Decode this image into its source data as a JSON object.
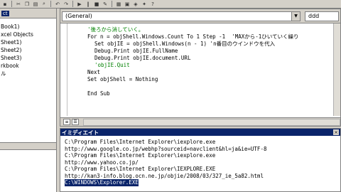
{
  "toolbar": {
    "undo_icon": "undo-icon",
    "redo_icon": "redo-icon",
    "run_icon": "run-icon",
    "pause_icon": "pause-icon",
    "stop_icon": "stop-icon"
  },
  "project": {
    "title": "ct",
    "items": [
      "Book1)",
      "xcel Objects",
      "Sheet1)",
      "Sheet2)",
      "Sheet3)",
      "rkbook",
      "ル"
    ]
  },
  "code": {
    "object_combo": "(General)",
    "proc_combo": "ddd",
    "lines": [
      {
        "text": "'後ろから消していく。",
        "type": "comment",
        "indent": 2
      },
      {
        "text": "For n = objShell.Windows.Count To 1 Step -1  'MAXから-1ひいていく繰り",
        "type": "code",
        "indent": 2
      },
      {
        "text": "Set objIE = objShell.Windows(n - 1) 'n番目のウインドウを代入",
        "type": "code",
        "indent": 3
      },
      {
        "text": "Debug.Print objIE.FullName",
        "type": "code",
        "indent": 3
      },
      {
        "text": "Debug.Print objIE.document.URL",
        "type": "code",
        "indent": 3
      },
      {
        "text": "'objIE.Quit",
        "type": "comment",
        "indent": 3
      },
      {
        "text": "Next",
        "type": "code",
        "indent": 2
      },
      {
        "text": "Set objShell = Nothing",
        "type": "code",
        "indent": 2
      },
      {
        "text": "",
        "type": "code",
        "indent": 0
      },
      {
        "text": "End Sub",
        "type": "code",
        "indent": 2
      }
    ]
  },
  "immediate": {
    "title": "イミディエイト",
    "lines": [
      "C:\\Program Files\\Internet Explorer\\iexplore.exe",
      "http://www.google.co.jp/webhp?sourceid=navclient&hl=ja&ie=UTF-8",
      "C:\\Program Files\\Internet Explorer\\iexplore.exe",
      "http://www.yahoo.co.jp/",
      "C:\\Program Files\\Internet Explorer\\IEXPLORE.EXE",
      "http://kan3-info.blog.ocn.ne.jp/objie/2008/03/327_ie_5a82.html",
      "C:\\WINDOWS\\Explorer.EXE"
    ]
  },
  "colors": {
    "comment": "#008000",
    "selection": "#0a246a",
    "chrome": "#d4d0c8"
  }
}
